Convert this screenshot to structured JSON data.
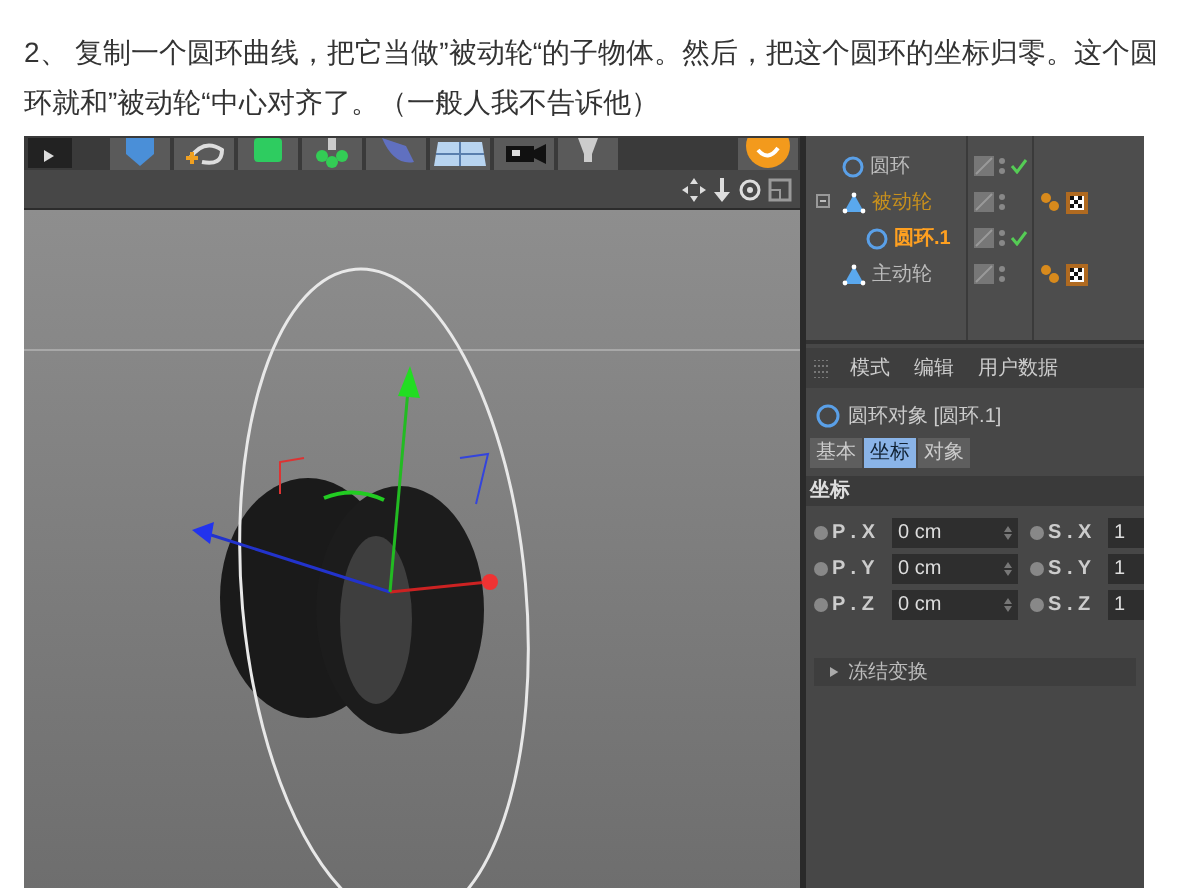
{
  "intro": "2、 复制一个圆环曲线，把它当做”被动轮“的子物体。然后，把这个圆环的坐标归零。这个圆环就和”被动轮“中心对齐了。（一般人我不告诉他）",
  "objects": [
    {
      "name": "圆环",
      "kind": "spline",
      "selected": false,
      "highlighted": false,
      "enabled": true,
      "tags": false
    },
    {
      "name": "被动轮",
      "kind": "null",
      "selected": false,
      "highlighted": true,
      "enabled": false,
      "tags": true,
      "expanded": true,
      "children": [
        {
          "name": "圆环.1",
          "kind": "spline",
          "selected": true,
          "highlighted": false,
          "enabled": true,
          "tags": false
        }
      ]
    },
    {
      "name": "主动轮",
      "kind": "null",
      "selected": false,
      "highlighted": false,
      "enabled": false,
      "tags": true
    }
  ],
  "attributes": {
    "menu": [
      "模式",
      "编辑",
      "用户数据"
    ],
    "title": "圆环对象 [圆环.1]",
    "tabs": [
      {
        "label": "基本",
        "selected": false
      },
      {
        "label": "坐标",
        "selected": true
      },
      {
        "label": "对象",
        "selected": false
      }
    ],
    "section": "坐标",
    "rows": [
      {
        "label": "P . X",
        "value": "0 cm",
        "scale_label": "S . X",
        "scale_value": "1"
      },
      {
        "label": "P . Y",
        "value": "0 cm",
        "scale_label": "S . Y",
        "scale_value": "1"
      },
      {
        "label": "P . Z",
        "value": "0 cm",
        "scale_label": "S . Z",
        "scale_value": "1"
      }
    ],
    "group": {
      "label": "冻结变换",
      "expanded": false
    }
  }
}
